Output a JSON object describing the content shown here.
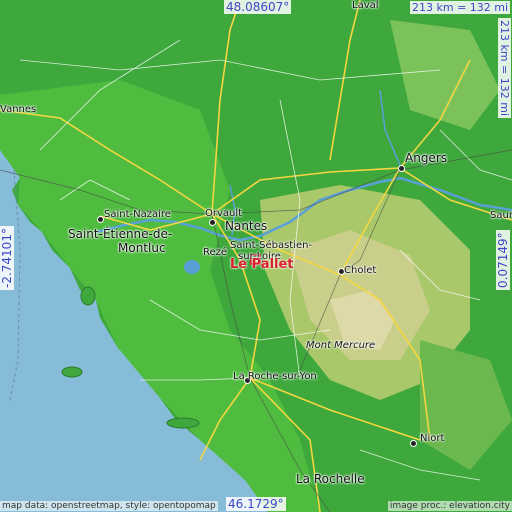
{
  "map": {
    "top_latitude": "48.08607°",
    "bottom_latitude": "46.1729°",
    "left_longitude": "-2.74101°",
    "right_longitude": "0.07149°",
    "scale_horizontal": "213 km = 132 mi",
    "scale_vertical": "213 km = 132 mi",
    "highlight_place": "Le Pallet",
    "places": {
      "vannes": "Vannes",
      "saint_nazaire": "Saint-Nazaire",
      "saint_etienne_1": "Saint-Étienne-de-",
      "saint_etienne_2": "Montluc",
      "orvault": "Orvault",
      "nantes": "Nantes",
      "reze": "Rezé",
      "saint_sebastien_1": "Saint-Sébastien-",
      "saint_sebastien_2": "sur-Loire",
      "angers": "Angers",
      "saumur": "Saum",
      "cholet": "Cholet",
      "mont_mercure": "Mont Mercure",
      "la_roche": "La Roche-sur-Yon",
      "niort": "Niort",
      "la_rochelle": "La Rochelle",
      "laval": "Laval"
    },
    "credit_left": "map data: openstreetmap, style: opentopomap",
    "credit_right": "image proc.: elevation.city"
  }
}
